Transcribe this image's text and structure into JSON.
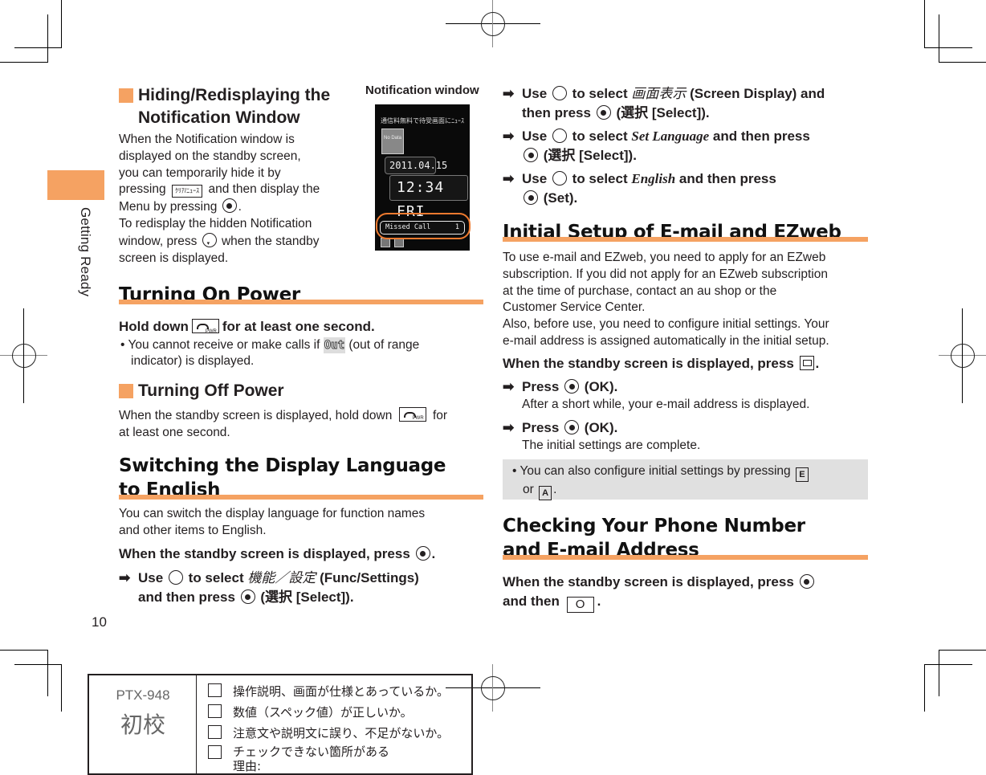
{
  "page": {
    "number": "10",
    "section_tab": "Getting Ready",
    "accent_color": "#f5a262"
  },
  "left": {
    "hiding": {
      "title_line1": "Hiding/Redisplaying the",
      "title_line2": "Notification Window",
      "p1": "When the Notification window is",
      "p2": "displayed on the standby screen,",
      "p3": "you can temporarily hide it by",
      "p4a": "pressing",
      "p4_key": "ｸﾘｱ/ﾆｭｰｽ",
      "p4b": "and then display the",
      "p5a": "Menu by pressing",
      "p5b": ".",
      "p6": "To redisplay the hidden Notification",
      "p7a": "window, press",
      "p7b": "when the standby",
      "p8": "screen is displayed."
    },
    "figure": {
      "caption": "Notification window",
      "ticker": "通信料無料で待受画面にﾆｭｰｽ",
      "no_data": "No Data",
      "date": "2011.04.15",
      "time": "12:34 FRI",
      "notif_label": "Missed Call",
      "notif_count": "1"
    },
    "power_on": {
      "heading": "Turning On Power",
      "step_a": "Hold down",
      "step_b": "for at least one second.",
      "bullet_a": "You cannot receive or make calls if",
      "out_icon": "Out",
      "bullet_b": "(out of range",
      "bullet_c": "indicator) is displayed."
    },
    "power_off": {
      "title": "Turning Off Power",
      "p1a": "When the standby screen is displayed, hold down",
      "p1b": "for",
      "p2": "at least one second."
    },
    "language": {
      "heading_line1": "Switching the Display Language",
      "heading_line2": "to English",
      "p1": "You can switch the display language for function names",
      "p2": "and other items to English.",
      "instr_a": "When the standby screen is displayed, press",
      "instr_b": ".",
      "step1_a": "Use",
      "step1_b": "to select",
      "step1_jp": "機能／設定",
      "step1_c": "(Func/Settings)",
      "step1_d": "and then press",
      "step1_e": "(選択 [Select])."
    }
  },
  "right": {
    "steps": [
      {
        "a": "Use",
        "b": "to select",
        "jp": "画面表示",
        "c": "(Screen Display) and",
        "d": "then press",
        "e": "(選択 [Select])."
      },
      {
        "a": "Use",
        "b": "to select",
        "it": "Set Language",
        "c": "and then press",
        "e": "(選択 [Select])."
      },
      {
        "a": "Use",
        "b": "to select",
        "it": "English",
        "c": "and then press",
        "e": "(Set)."
      }
    ],
    "email": {
      "heading": "Initial Setup of E-mail and EZweb",
      "p1": "To use e-mail and EZweb, you need to apply for an EZweb",
      "p2": "subscription. If you did not apply for an EZweb subscription",
      "p3": "at the time of purchase, contact an au shop or the",
      "p4": "Customer Service Center.",
      "p5": "Also, before use, you need to configure initial settings. Your",
      "p6": "e-mail address is assigned automatically in the initial setup.",
      "instr_a": "When the standby screen is displayed, press",
      "instr_b": ".",
      "step1": "Press",
      "step1_b": "(OK).",
      "step1_note": "After a short while, your e-mail address is displayed.",
      "step2": "Press",
      "step2_b": "(OK).",
      "step2_note": "The initial settings are complete.",
      "tip_a": "You can also configure initial settings by pressing",
      "tip_key1": "E",
      "tip_b": "or",
      "tip_key2": "A",
      "tip_c": "."
    },
    "check": {
      "heading_line1": "Checking Your Phone Number",
      "heading_line2": "and E-mail Address",
      "instr_a": "When the standby screen is displayed, press",
      "instr_b": "and then",
      "key": "O",
      "instr_c": "."
    }
  },
  "proof": {
    "code": "PTX-948",
    "stage": "初校",
    "items": [
      "操作説明、画面が仕様とあっているか。",
      "数値（スペック値）が正しいか。",
      "注意文や説明文に誤り、不足がないか。",
      "チェックできない箇所がある"
    ],
    "reason_label": "理由:"
  }
}
